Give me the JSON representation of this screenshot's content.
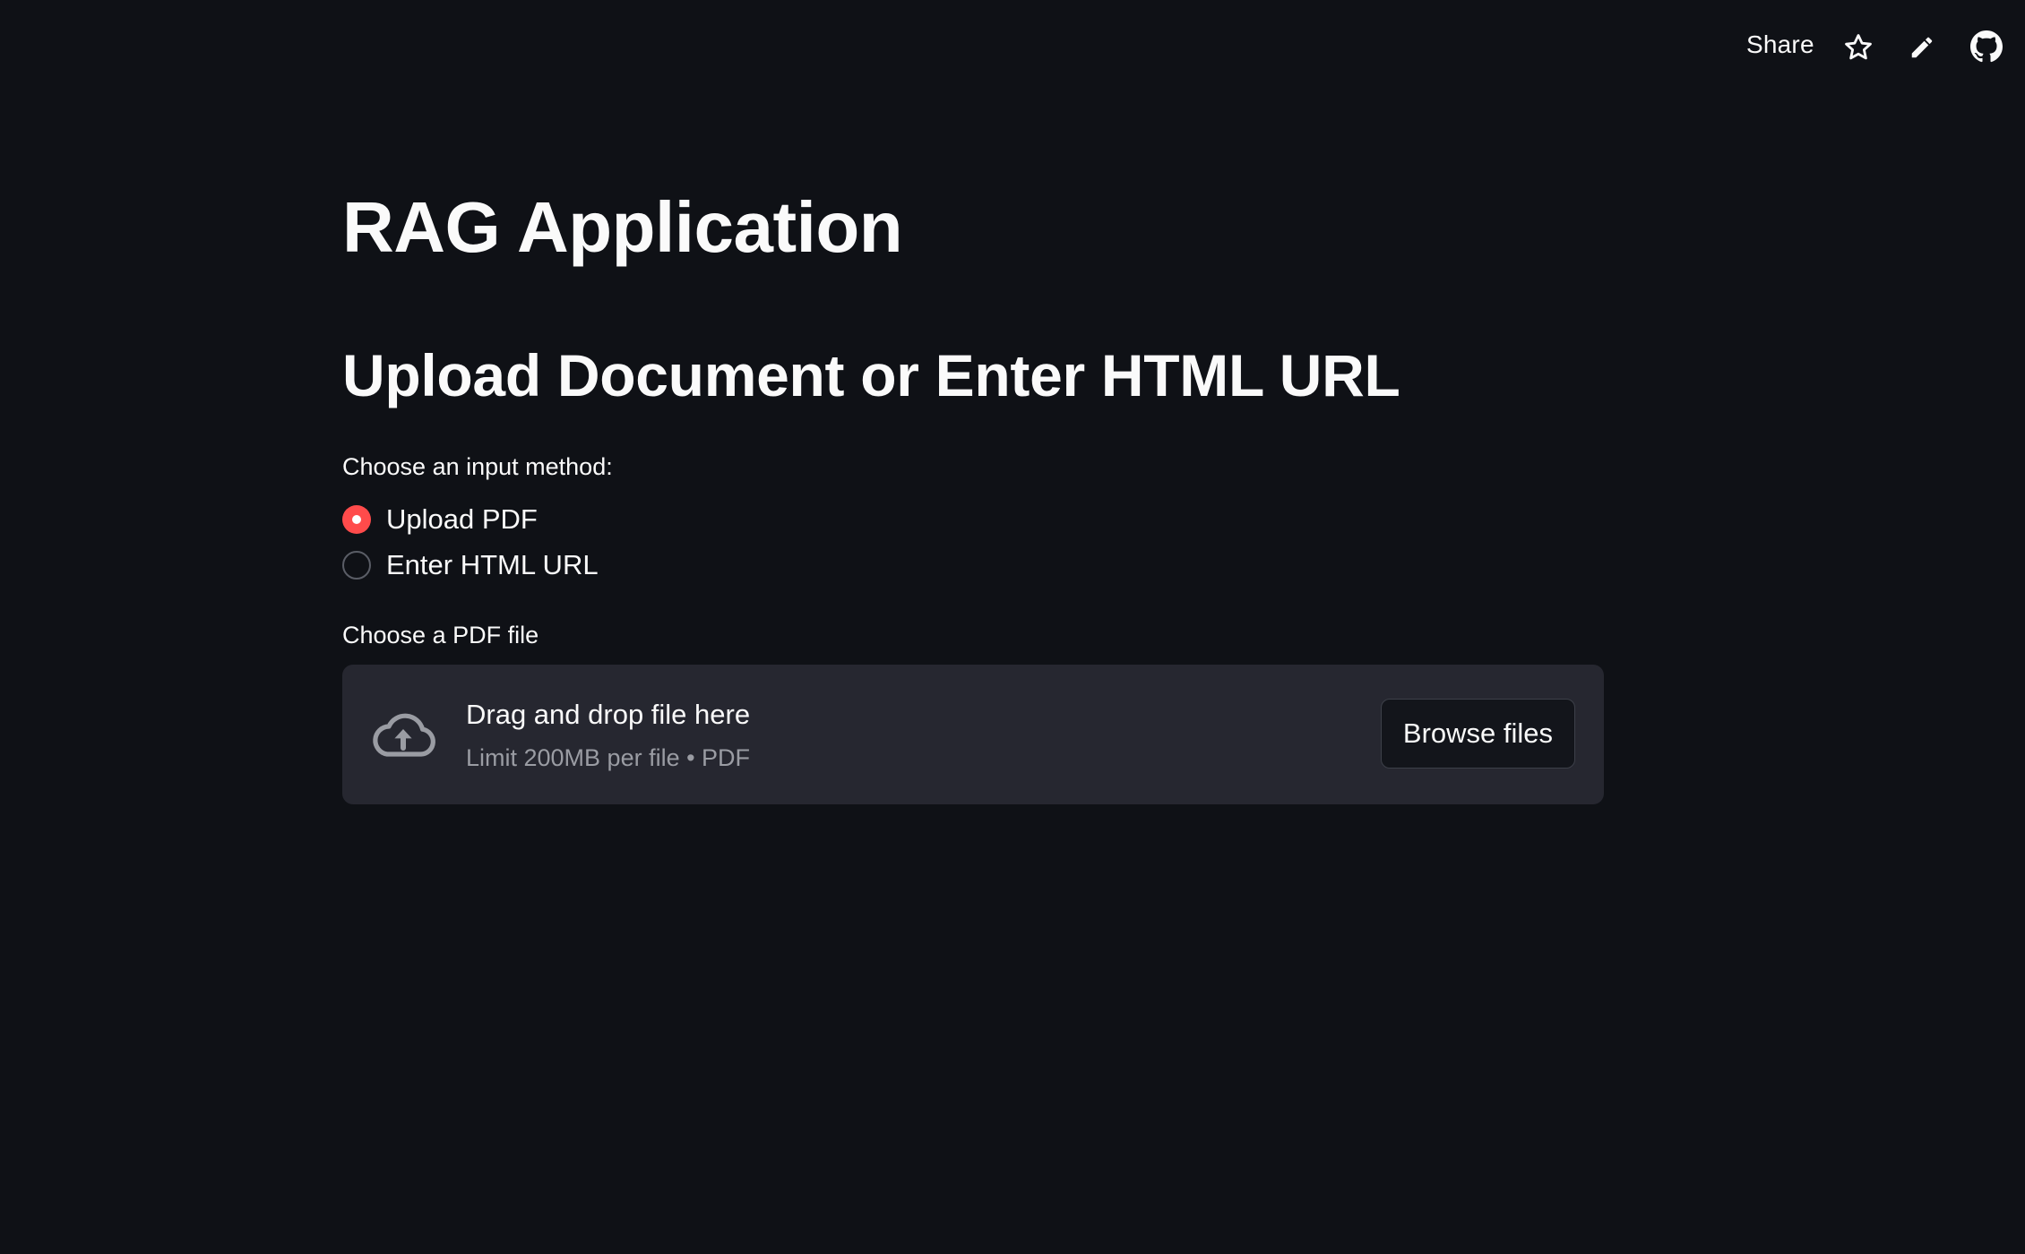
{
  "toolbar": {
    "share_label": "Share",
    "icons": [
      "star-icon",
      "pencil-icon",
      "github-icon"
    ]
  },
  "main": {
    "title": "RAG Application",
    "subtitle": "Upload Document or Enter HTML URL",
    "input_method": {
      "label": "Choose an input method:",
      "options": [
        {
          "label": "Upload PDF",
          "selected": true
        },
        {
          "label": "Enter HTML URL",
          "selected": false
        }
      ]
    },
    "uploader": {
      "label": "Choose a PDF file",
      "drop_text": "Drag and drop file here",
      "limit_text": "Limit 200MB per file • PDF",
      "browse_label": "Browse files",
      "icon": "cloud-upload-icon"
    }
  },
  "colors": {
    "background": "#0f1116",
    "accent": "#ff4b4b",
    "dropzone": "#262730",
    "text": "#fafafa",
    "muted_text": "#9a9ca3"
  }
}
